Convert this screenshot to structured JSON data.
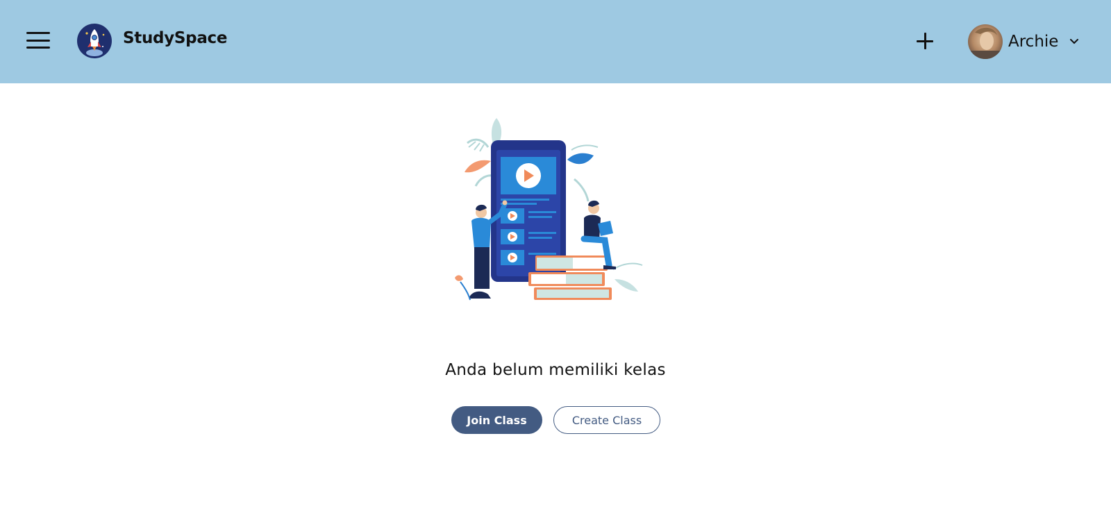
{
  "colors": {
    "header_bg": "#9ec9e2",
    "primary": "#435b82",
    "text": "#111111"
  },
  "header": {
    "brand": "StudySpace",
    "user_name": "Archie",
    "icons": {
      "menu": "hamburger-menu-icon",
      "logo": "rocket-logo-icon",
      "add": "plus-icon",
      "dropdown": "chevron-down-icon"
    }
  },
  "main": {
    "empty_message": "Anda belum memiliki kelas",
    "join_label": "Join Class",
    "create_label": "Create Class"
  }
}
